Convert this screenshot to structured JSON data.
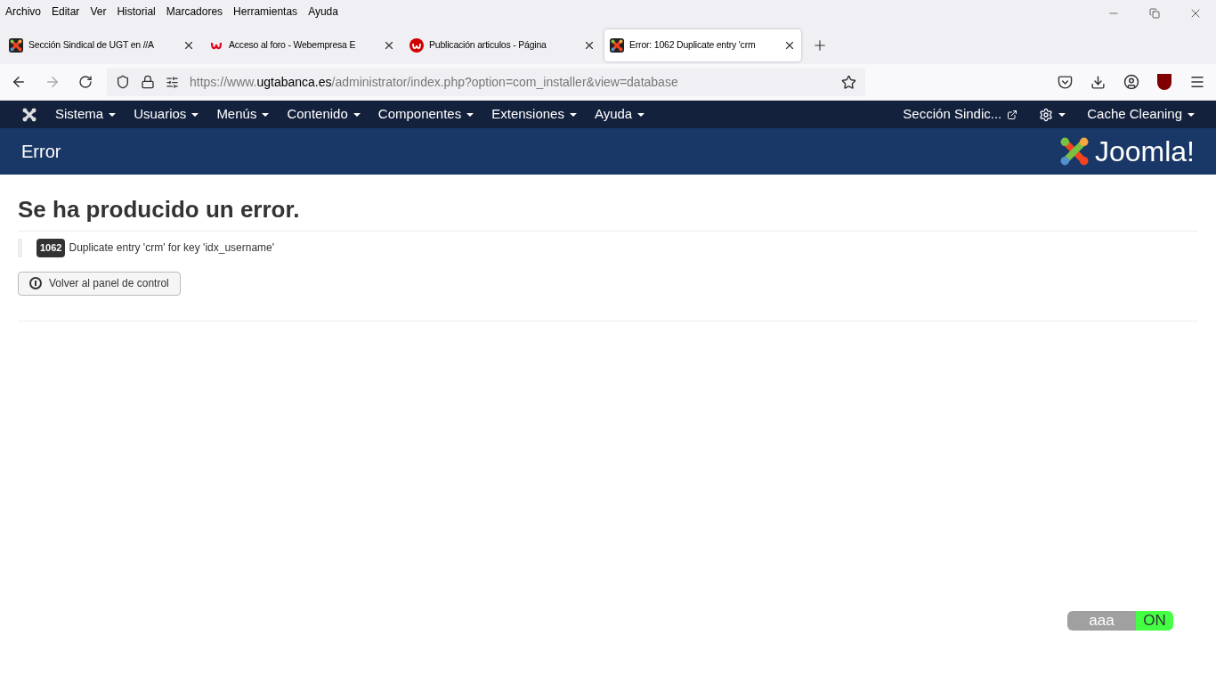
{
  "menu_bar": [
    "Archivo",
    "Editar",
    "Ver",
    "Historial",
    "Marcadores",
    "Herramientas",
    "Ayuda"
  ],
  "tabs": [
    {
      "title": "Sección Sindical de UGT en //A",
      "selected": false,
      "kind": "joomla"
    },
    {
      "title": "Acceso al foro - Webempresa E",
      "selected": false,
      "kind": "webempresa"
    },
    {
      "title": "Publicación articulos - Página",
      "selected": false,
      "kind": "webempresa-round"
    },
    {
      "title": "Error: 1062 Duplicate entry 'crm",
      "selected": true,
      "kind": "joomla"
    }
  ],
  "address_bar": {
    "scheme": "https://www.",
    "domain": "ugtabanca.es",
    "path": "/administrator/index.php?option=com_installer&view=database"
  },
  "admin_nav": {
    "items": [
      "Sistema",
      "Usuarios",
      "Menús",
      "Contenido",
      "Componentes",
      "Extensiones",
      "Ayuda"
    ],
    "site_link": "Sección Sindic...",
    "user_menu": "Cache Cleaning"
  },
  "header": {
    "title": "Error",
    "logo_text": "Joomla!"
  },
  "error": {
    "heading": "Se ha producido un error.",
    "code": "1062",
    "message": "Duplicate entry 'crm' for key 'idx_username'",
    "button": "Volver al panel de control"
  },
  "toggle": {
    "label": "aaa",
    "state_text": "ON",
    "on": true
  }
}
